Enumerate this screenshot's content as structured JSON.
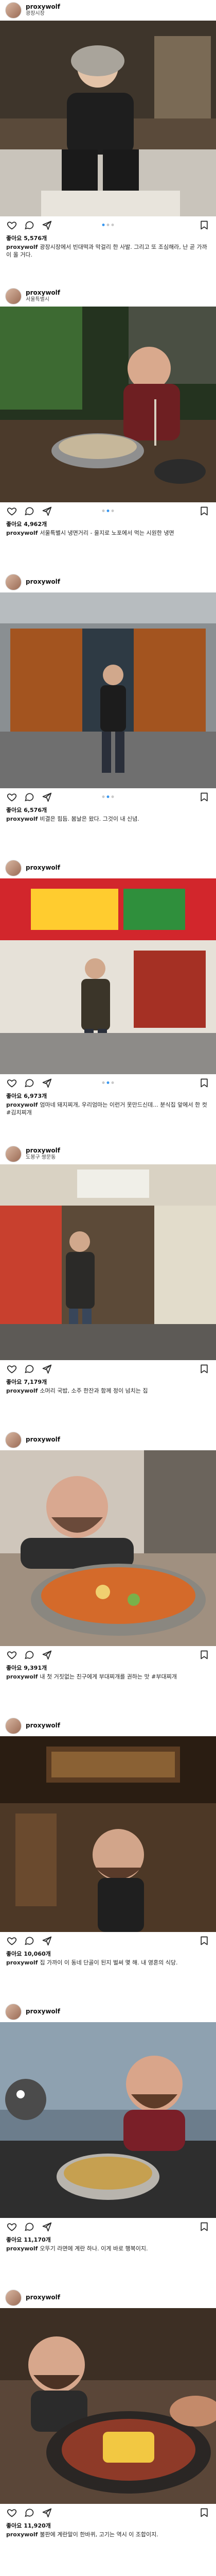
{
  "colors": {
    "like": "#262626",
    "dot_active": "#3897f0",
    "dot_inactive": "#c8c8c8"
  },
  "icons": [
    "heart-icon",
    "comment-icon",
    "share-icon",
    "bookmark-icon"
  ],
  "posts": [
    {
      "username": "proxywolf",
      "location": "광장시장",
      "likes": "좋아요 5,576개",
      "caption": "광장시장에서 빈대떡과 막걸리 한 사발. 그리고 또 조심해라, 난 곧 가까이 올 거다."
    },
    {
      "username": "proxywolf",
      "location": "서울특별시",
      "likes": "좋아요 4,962개",
      "caption": "서울특별시 냉면거리 - 을지로 노포에서 먹는 시원한 냉면"
    },
    {
      "username": "proxywolf",
      "location": "",
      "likes": "좋아요 6,576개",
      "caption": "비결은 힘듬. 봄날은 왔다. 그것이 내 신념."
    },
    {
      "username": "proxywolf",
      "location": "",
      "likes": "좋아요 6,973개",
      "caption": "엄마네 돼지찌개, 우리엄마는 이런거 못만드신데... 분식집 앞에서 한 컷 #김치찌개"
    },
    {
      "username": "proxywolf",
      "location": "도봉구 쌍문동",
      "likes": "좋아요 7,179개",
      "caption": "소머리 국밥, 소주 한잔과 함께 정이 넘치는 집"
    },
    {
      "username": "proxywolf",
      "location": "",
      "likes": "좋아요 9,391개",
      "caption": "내 첫 거짓없는 친구에게 부대찌개를 권하는 맛 #부대찌개"
    },
    {
      "username": "proxywolf",
      "location": "",
      "likes": "좋아요 10,060개",
      "caption": "집 가까이 이 동네 단골이 된지 벌써 몇 해. 내 영혼의 식당."
    },
    {
      "username": "proxywolf",
      "location": "",
      "likes": "좋아요 11,170개",
      "caption": "오뚜기 라면에 계란 하나. 이게 바로 행복이지."
    },
    {
      "username": "proxywolf",
      "location": "",
      "likes": "좋아요 11,920개",
      "caption": "불판에 계란말이 한바퀴, 고기는 역시 이 조합이지."
    }
  ]
}
